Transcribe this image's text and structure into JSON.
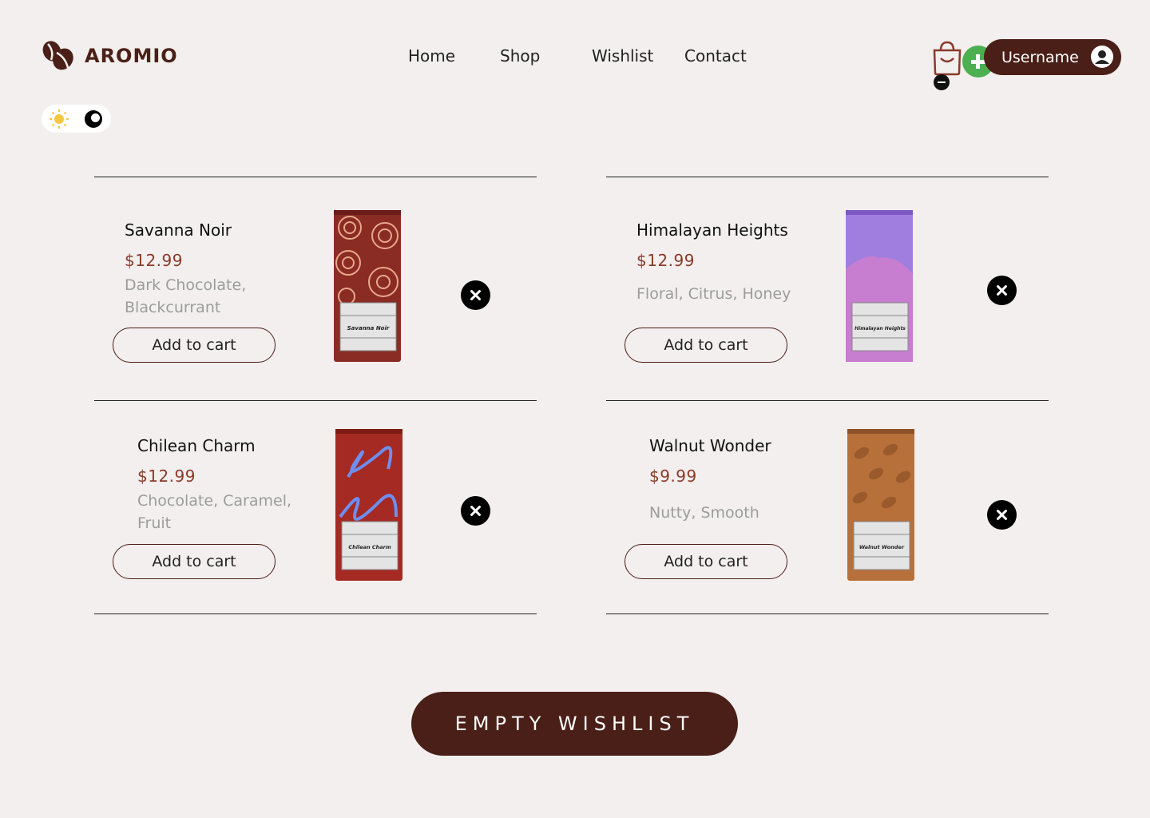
{
  "header": {
    "brand": "AROMIO",
    "nav": [
      "Home",
      "Shop",
      "Wishlist",
      "Contact"
    ],
    "username": "Username"
  },
  "icons": {
    "logo": "coffee-beans-icon",
    "cart": "shopping-bag-icon",
    "cart_add": "plus-icon",
    "cart_remove": "minus-icon",
    "avatar": "user-avatar-icon",
    "light": "sun-icon",
    "dark": "moon-icon",
    "remove": "close-icon"
  },
  "colors": {
    "background": "#f2efee",
    "brand": "#4a1f17",
    "price": "#8a3a2a",
    "notes": "#9c9c9c",
    "add": "#4caf50"
  },
  "wishlist": {
    "items": [
      {
        "name": "Savanna Noir",
        "price": "$12.99",
        "notes": "Dark Chocolate, Blackcurrant",
        "cta": "Add to cart",
        "bag_label": "Savanna Noir",
        "bag_color": "#8a2b24"
      },
      {
        "name": "Himalayan Heights",
        "price": "$12.99",
        "notes": "Floral, Citrus, Honey",
        "cta": "Add to cart",
        "bag_label": "Himalayan Heights",
        "bag_color": "#a07ee0"
      },
      {
        "name": "Chilean Charm",
        "price": "$12.99",
        "notes": "Chocolate, Caramel, Fruit",
        "cta": "Add to cart",
        "bag_label": "Chilean Charm",
        "bag_color": "#a52a23"
      },
      {
        "name": "Walnut Wonder",
        "price": "$9.99",
        "notes": "Nutty, Smooth",
        "cta": "Add to cart",
        "bag_label": "Walnut Wonder",
        "bag_color": "#b8703a"
      }
    ],
    "empty_label": "EMPTY WISHLIST"
  }
}
